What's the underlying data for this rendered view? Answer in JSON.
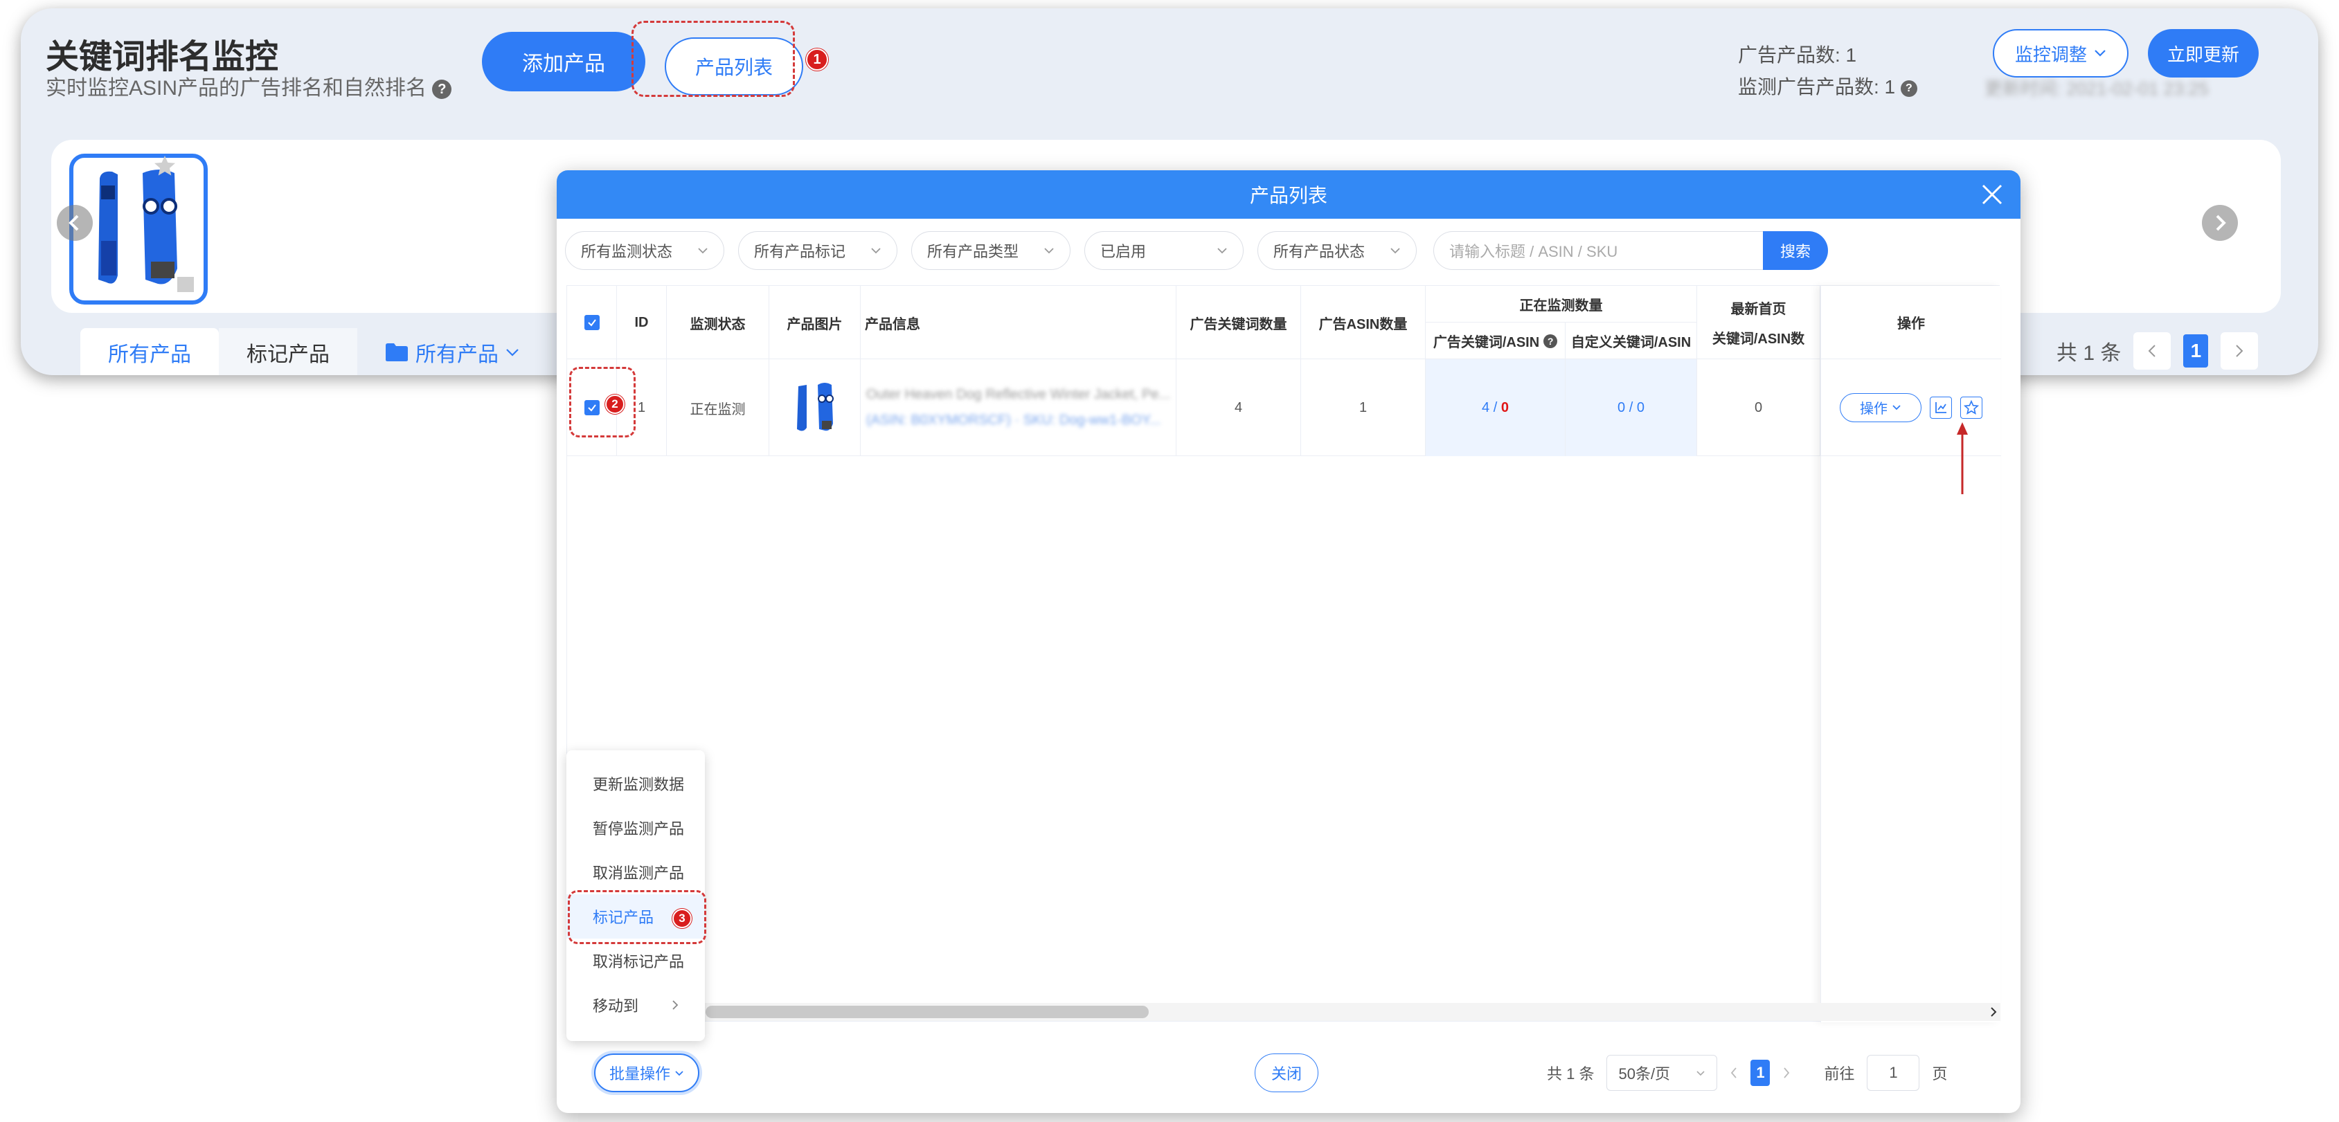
{
  "page": {
    "title": "关键词排名监控",
    "subtitle": "实时监控ASIN产品的广告排名和自然排名",
    "add_product_label": "添加产品",
    "product_list_label": "产品列表",
    "ad_product_count_label": "广告产品数: 1",
    "monitored_ad_count_label": "监测广告产品数: 1",
    "updated_time_label": "更新时间: 2021-02-01 23:25",
    "adjust_label": "监控调整",
    "refresh_label": "立即更新",
    "tabs": [
      {
        "label": "所有产品"
      },
      {
        "label": "标记产品"
      },
      {
        "label": "所有产品"
      }
    ],
    "pager": {
      "total_label": "共 1 条",
      "current_page": "1"
    }
  },
  "modal": {
    "title": "产品列表",
    "filters": [
      {
        "label": "所有监测状态"
      },
      {
        "label": "所有产品标记"
      },
      {
        "label": "所有产品类型"
      },
      {
        "label": "已启用"
      },
      {
        "label": "所有产品状态"
      }
    ],
    "search_placeholder": "请输入标题 / ASIN / SKU",
    "search_label": "搜索",
    "columns": {
      "id": "ID",
      "status": "监测状态",
      "image": "产品图片",
      "info": "产品信息",
      "ad_keywords": "广告关键词数量",
      "ad_asins": "广告ASIN数量",
      "monitoring_group": "正在监测数量",
      "ad_kw_asin": "广告关键词/ASIN",
      "custom_kw_asin": "自定义关键词/ASIN",
      "latest_first_page": "最新首页",
      "latest_first_page_sub": "关键词/ASIN数",
      "actions": "操作"
    },
    "rows": [
      {
        "id": "1",
        "status": "正在监测",
        "info_title": "Outer Heaven Dog Reflective Winter Jacket, Pe...",
        "info_meta": "(ASIN: B0XYMORSCF) · SKU: Dog-ww1-BOY...",
        "ad_keywords": "4",
        "ad_asins": "1",
        "ad_kw_monitored": "4",
        "ad_kw_sep": " / ",
        "ad_kw_alert": "0",
        "custom_kw": "0 / 0",
        "latest_first_page": "0",
        "action_label": "操作"
      }
    ],
    "batch_menu": [
      {
        "label": "更新监测数据"
      },
      {
        "label": "暂停监测产品"
      },
      {
        "label": "取消监测产品"
      },
      {
        "label": "标记产品"
      },
      {
        "label": "取消标记产品"
      },
      {
        "label": "移动到"
      }
    ],
    "batch_label": "批量操作",
    "close_label": "关闭",
    "footer": {
      "total_label": "共 1 条",
      "page_size": "50条/页",
      "current_page": "1",
      "goto_label": "前往",
      "goto_value": "1",
      "page_unit": "页"
    }
  },
  "annotations": {
    "step1": "1",
    "step2": "2",
    "step3": "3"
  },
  "colors": {
    "accent": "#2f7cf6",
    "modal_header": "#3389f5",
    "annotation": "#d43a3a",
    "alert": "#e01616"
  }
}
